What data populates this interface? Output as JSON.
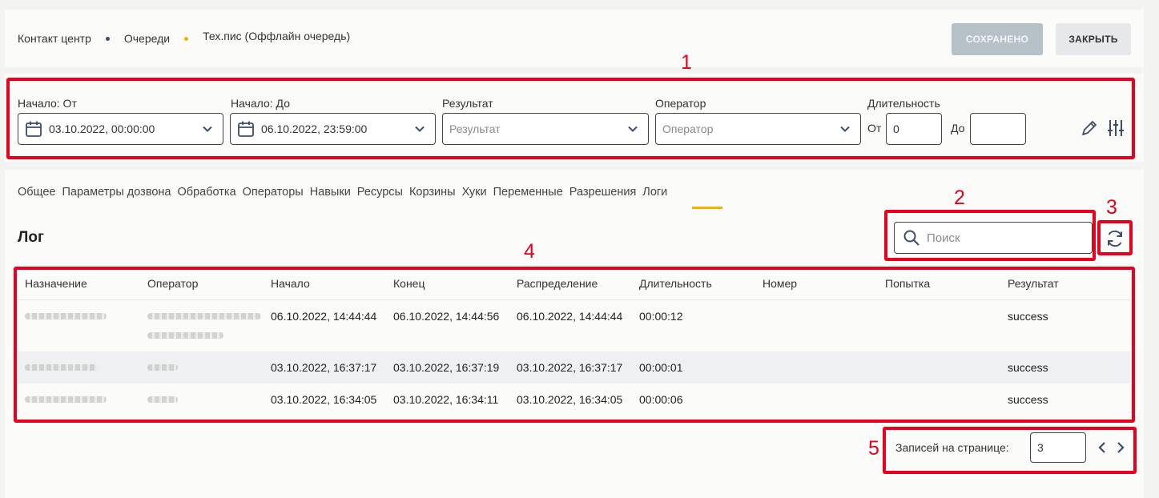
{
  "breadcrumbs": [
    "Контакт центр",
    "Очереди",
    "Тех.пис (Оффлайн очередь)"
  ],
  "breadcrumb_dot_colors": [
    "#3b4d6b",
    "#f2b200"
  ],
  "header": {
    "saved_label": "СОХРАНЕНО",
    "close_label": "ЗАКРЫТЬ"
  },
  "filters": {
    "start_from": {
      "label": "Начало: От",
      "value": "03.10.2022, 00:00:00"
    },
    "start_to": {
      "label": "Начало: До",
      "value": "06.10.2022, 23:59:00"
    },
    "result": {
      "label": "Результат",
      "placeholder": "Результат"
    },
    "operator": {
      "label": "Оператор",
      "placeholder": "Оператор"
    },
    "duration": {
      "label": "Длительность",
      "from_label": "От",
      "from_value": "0",
      "to_label": "До",
      "to_value": ""
    }
  },
  "tabs": [
    "Общее",
    "Параметры дозвона",
    "Обработка",
    "Операторы",
    "Навыки",
    "Ресурсы",
    "Корзины",
    "Хуки",
    "Переменные",
    "Разрешения",
    "Логи"
  ],
  "active_tab": "Логи",
  "log": {
    "title": "Лог",
    "search_placeholder": "Поиск",
    "columns": [
      "Назначение",
      "Оператор",
      "Начало",
      "Конец",
      "Распределение",
      "Длительность",
      "Номер",
      "Попытка",
      "Результат"
    ],
    "rows": [
      {
        "start": "06.10.2022, 14:44:44",
        "end": "06.10.2022, 14:44:56",
        "distribution": "06.10.2022, 14:44:44",
        "duration": "00:00:12",
        "number": "",
        "attempt": "",
        "result": "success"
      },
      {
        "start": "03.10.2022, 16:37:17",
        "end": "03.10.2022, 16:37:19",
        "distribution": "03.10.2022, 16:37:17",
        "duration": "00:00:01",
        "number": "",
        "attempt": "",
        "result": "success"
      },
      {
        "start": "03.10.2022, 16:34:05",
        "end": "03.10.2022, 16:34:11",
        "distribution": "03.10.2022, 16:34:05",
        "duration": "00:00:06",
        "number": "",
        "attempt": "",
        "result": "success"
      }
    ]
  },
  "pagination": {
    "label": "Записей на странице:",
    "value": "3"
  },
  "annotations": [
    "1",
    "2",
    "3",
    "4",
    "5"
  ],
  "colors": {
    "annotation_red": "#e8001c",
    "tab_active_underline": "#f2b200",
    "saved_button": "#b7c1c8"
  }
}
